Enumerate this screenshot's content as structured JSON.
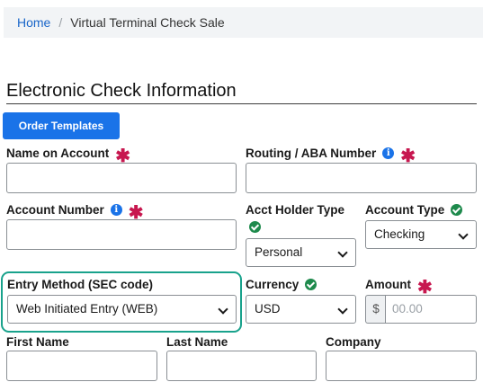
{
  "breadcrumb": {
    "home": "Home",
    "separator": "/",
    "current": "Virtual Terminal Check Sale"
  },
  "section": {
    "title": "Electronic Check Information",
    "order_templates_button": "Order Templates"
  },
  "fields": {
    "name_on_account": {
      "label": "Name on Account",
      "required": "✱",
      "value": ""
    },
    "routing_number": {
      "label": "Routing / ABA Number",
      "required": "✱",
      "value": ""
    },
    "account_number": {
      "label": "Account Number",
      "required": "✱",
      "value": ""
    },
    "acct_holder_type": {
      "label": "Acct Holder Type",
      "selected": "Personal"
    },
    "account_type": {
      "label": "Account Type",
      "selected": "Checking"
    },
    "entry_method": {
      "label": "Entry Method (SEC code)",
      "selected": "Web Initiated Entry (WEB)"
    },
    "currency": {
      "label": "Currency",
      "selected": "USD"
    },
    "amount": {
      "label": "Amount",
      "required": "✱",
      "prefix": "$",
      "placeholder": "00.00"
    },
    "first_name": {
      "label": "First Name",
      "value": ""
    },
    "last_name": {
      "label": "Last Name",
      "value": ""
    },
    "company": {
      "label": "Company",
      "value": ""
    }
  },
  "icons": {
    "info_glyph": "i"
  },
  "colors": {
    "primary": "#1a73e8",
    "required": "#c7174f",
    "valid": "#1e8a4c",
    "highlight": "#19a28c",
    "link": "#1a66c9"
  }
}
